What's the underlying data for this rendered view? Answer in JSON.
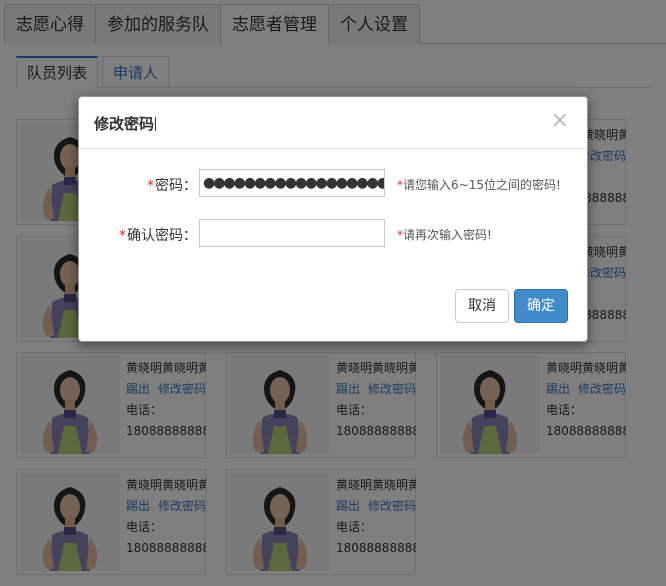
{
  "main_tabs": [
    {
      "label": "志愿心得",
      "active": false
    },
    {
      "label": "参加的服务队",
      "active": false
    },
    {
      "label": "志愿者管理",
      "active": true
    },
    {
      "label": "个人设置",
      "active": false
    }
  ],
  "sub_tabs": [
    {
      "label": "队员列表",
      "active": true
    },
    {
      "label": "申请人",
      "active": false
    }
  ],
  "member_card": {
    "name": "黄晓明黄晓明黄",
    "link_remove": "踢出",
    "link_change_pwd": "修改密码",
    "phone_label": "电话：",
    "phone": "18088888888"
  },
  "modal": {
    "title": "修改密码",
    "close_glyph": "×",
    "password_label": "密码：",
    "password_value": "●●●●●●●●●●●●●●●●●●●●●●●●",
    "password_hint": "请您输入6~15位之间的密码!",
    "confirm_label": "确认密码：",
    "confirm_value": "",
    "confirm_hint": "请再次输入密码!",
    "required_mark": "*",
    "cancel_label": "取消",
    "ok_label": "确定"
  },
  "colors": {
    "link": "#3778c4",
    "primary_button": "#428bca",
    "required": "#d9342b"
  }
}
